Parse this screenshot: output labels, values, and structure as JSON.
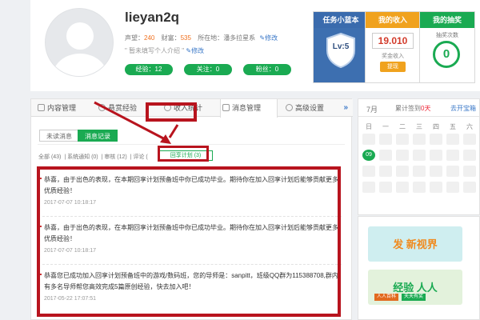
{
  "profile": {
    "username": "lieyan2q",
    "stats": {
      "prestige_label": "声望：",
      "prestige": "240",
      "wealth_label": "财富：",
      "wealth": "535",
      "location_label": "所在地：",
      "location": "潘多拉星系",
      "edit": "修改"
    },
    "intro": {
      "text": "\" 暂未填写个人介绍 \"",
      "edit": "修改"
    },
    "pills": [
      "经验：12",
      "关注：0",
      "粉丝：0"
    ]
  },
  "cards": {
    "task": {
      "title": "任务小蓝本",
      "level": "Lv:5"
    },
    "income": {
      "title": "我的收入",
      "amount": "19.010",
      "label": "奖金收入",
      "withdraw": "提现"
    },
    "lottery": {
      "title": "我的抽奖",
      "label": "抽奖次数",
      "count": "0"
    }
  },
  "tabs": {
    "items": [
      "内容管理",
      "悬赏经验",
      "收入统计",
      "消息管理",
      "高级设置"
    ],
    "more": "»"
  },
  "subtabs": [
    "未读消息",
    "消息记录"
  ],
  "filters": {
    "all": "全部 (43)",
    "system": "系统通知 (0)",
    "review": "审核 (12)",
    "comment": "评论 (",
    "active": "回享计划 (3)"
  },
  "messages": [
    {
      "text": "恭喜，由于出色的表现，在本期回享计划预备班中你已成功毕业。期待你在加入回享计划后能够贡献更多优质经验！",
      "time": "2017-07-07 10:18:17"
    },
    {
      "text": "恭喜，由于出色的表现，在本期回享计划预备班中你已成功毕业。期待你在加入回享计划后能够贡献更多优质经验！",
      "time": "2017-07-07 10:18:17"
    },
    {
      "text": "恭喜您已成功加入回享计划预备班中的游戏/数码班，您的导师是：sanpitt，班级QQ群为115388708,群内有多名导师帮您高效完成5篇原创经验，快去加入吧！",
      "time": "2017-05-22 17:07:51"
    }
  ],
  "calendar": {
    "month": "7月",
    "sign_prefix": "累计签到",
    "sign_days": "0天",
    "link": "去开宝箱",
    "weekdays": [
      "日",
      "一",
      "二",
      "三",
      "四",
      "五",
      "六"
    ],
    "today": "09",
    "today_index": 7,
    "cells": 28
  },
  "banners": {
    "first": "发 新视界",
    "second": "经验 人人",
    "tag1": "人人百科",
    "tag2": "天天有奖"
  }
}
